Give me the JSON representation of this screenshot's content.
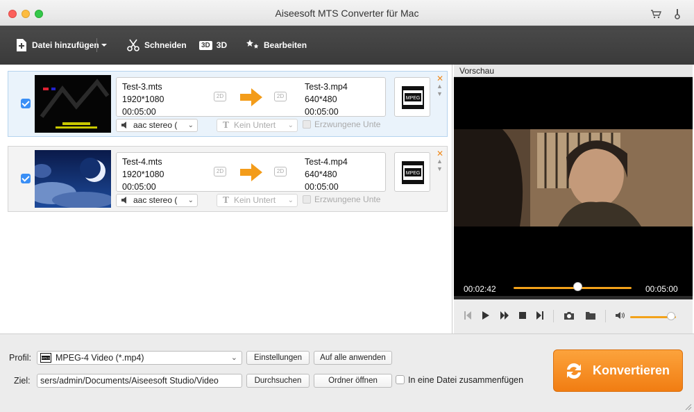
{
  "window": {
    "title": "Aiseesoft MTS Converter für Mac"
  },
  "toolbar": {
    "add_file": "Datei hinzufügen",
    "cut": "Schneiden",
    "three_d_badge": "3D",
    "three_d": "3D",
    "edit": "Bearbeiten"
  },
  "files": [
    {
      "source": {
        "name": "Test-3.mts",
        "resolution": "1920*1080",
        "duration": "00:05:00"
      },
      "target": {
        "name": "Test-3.mp4",
        "resolution": "640*480",
        "duration": "00:05:00"
      },
      "badge_2d": "2D",
      "format_icon": "MPEG",
      "audio": "aac stereo (",
      "subtitle": "Kein Untert",
      "forced": "Erzwungene Unte"
    },
    {
      "source": {
        "name": "Test-4.mts",
        "resolution": "1920*1080",
        "duration": "00:05:00"
      },
      "target": {
        "name": "Test-4.mp4",
        "resolution": "640*480",
        "duration": "00:05:00"
      },
      "badge_2d": "2D",
      "format_icon": "MPEG",
      "audio": "aac stereo (",
      "subtitle": "Kein Untert",
      "forced": "Erzwungene Unte"
    }
  ],
  "preview": {
    "label": "Vorschau",
    "current_time": "00:02:42",
    "total_time": "00:05:00",
    "progress": 0.54,
    "volume": 0.9
  },
  "bottom": {
    "profile_label": "Profil:",
    "profile_icon": "MPEG",
    "profile_value": "MPEG-4 Video (*.mp4)",
    "settings_button": "Einstellungen",
    "apply_all_button": "Auf alle anwenden",
    "target_label": "Ziel:",
    "target_path": "sers/admin/Documents/Aiseesoft Studio/Video",
    "browse_button": "Durchsuchen",
    "open_folder_button": "Ordner öffnen",
    "merge_label": "In eine Datei zusammenfügen",
    "convert_button": "Konvertieren"
  },
  "colors": {
    "accent": "#f39c1a",
    "toolbar_bg": "#3f3f3f",
    "checkbox": "#3a8ff5"
  }
}
